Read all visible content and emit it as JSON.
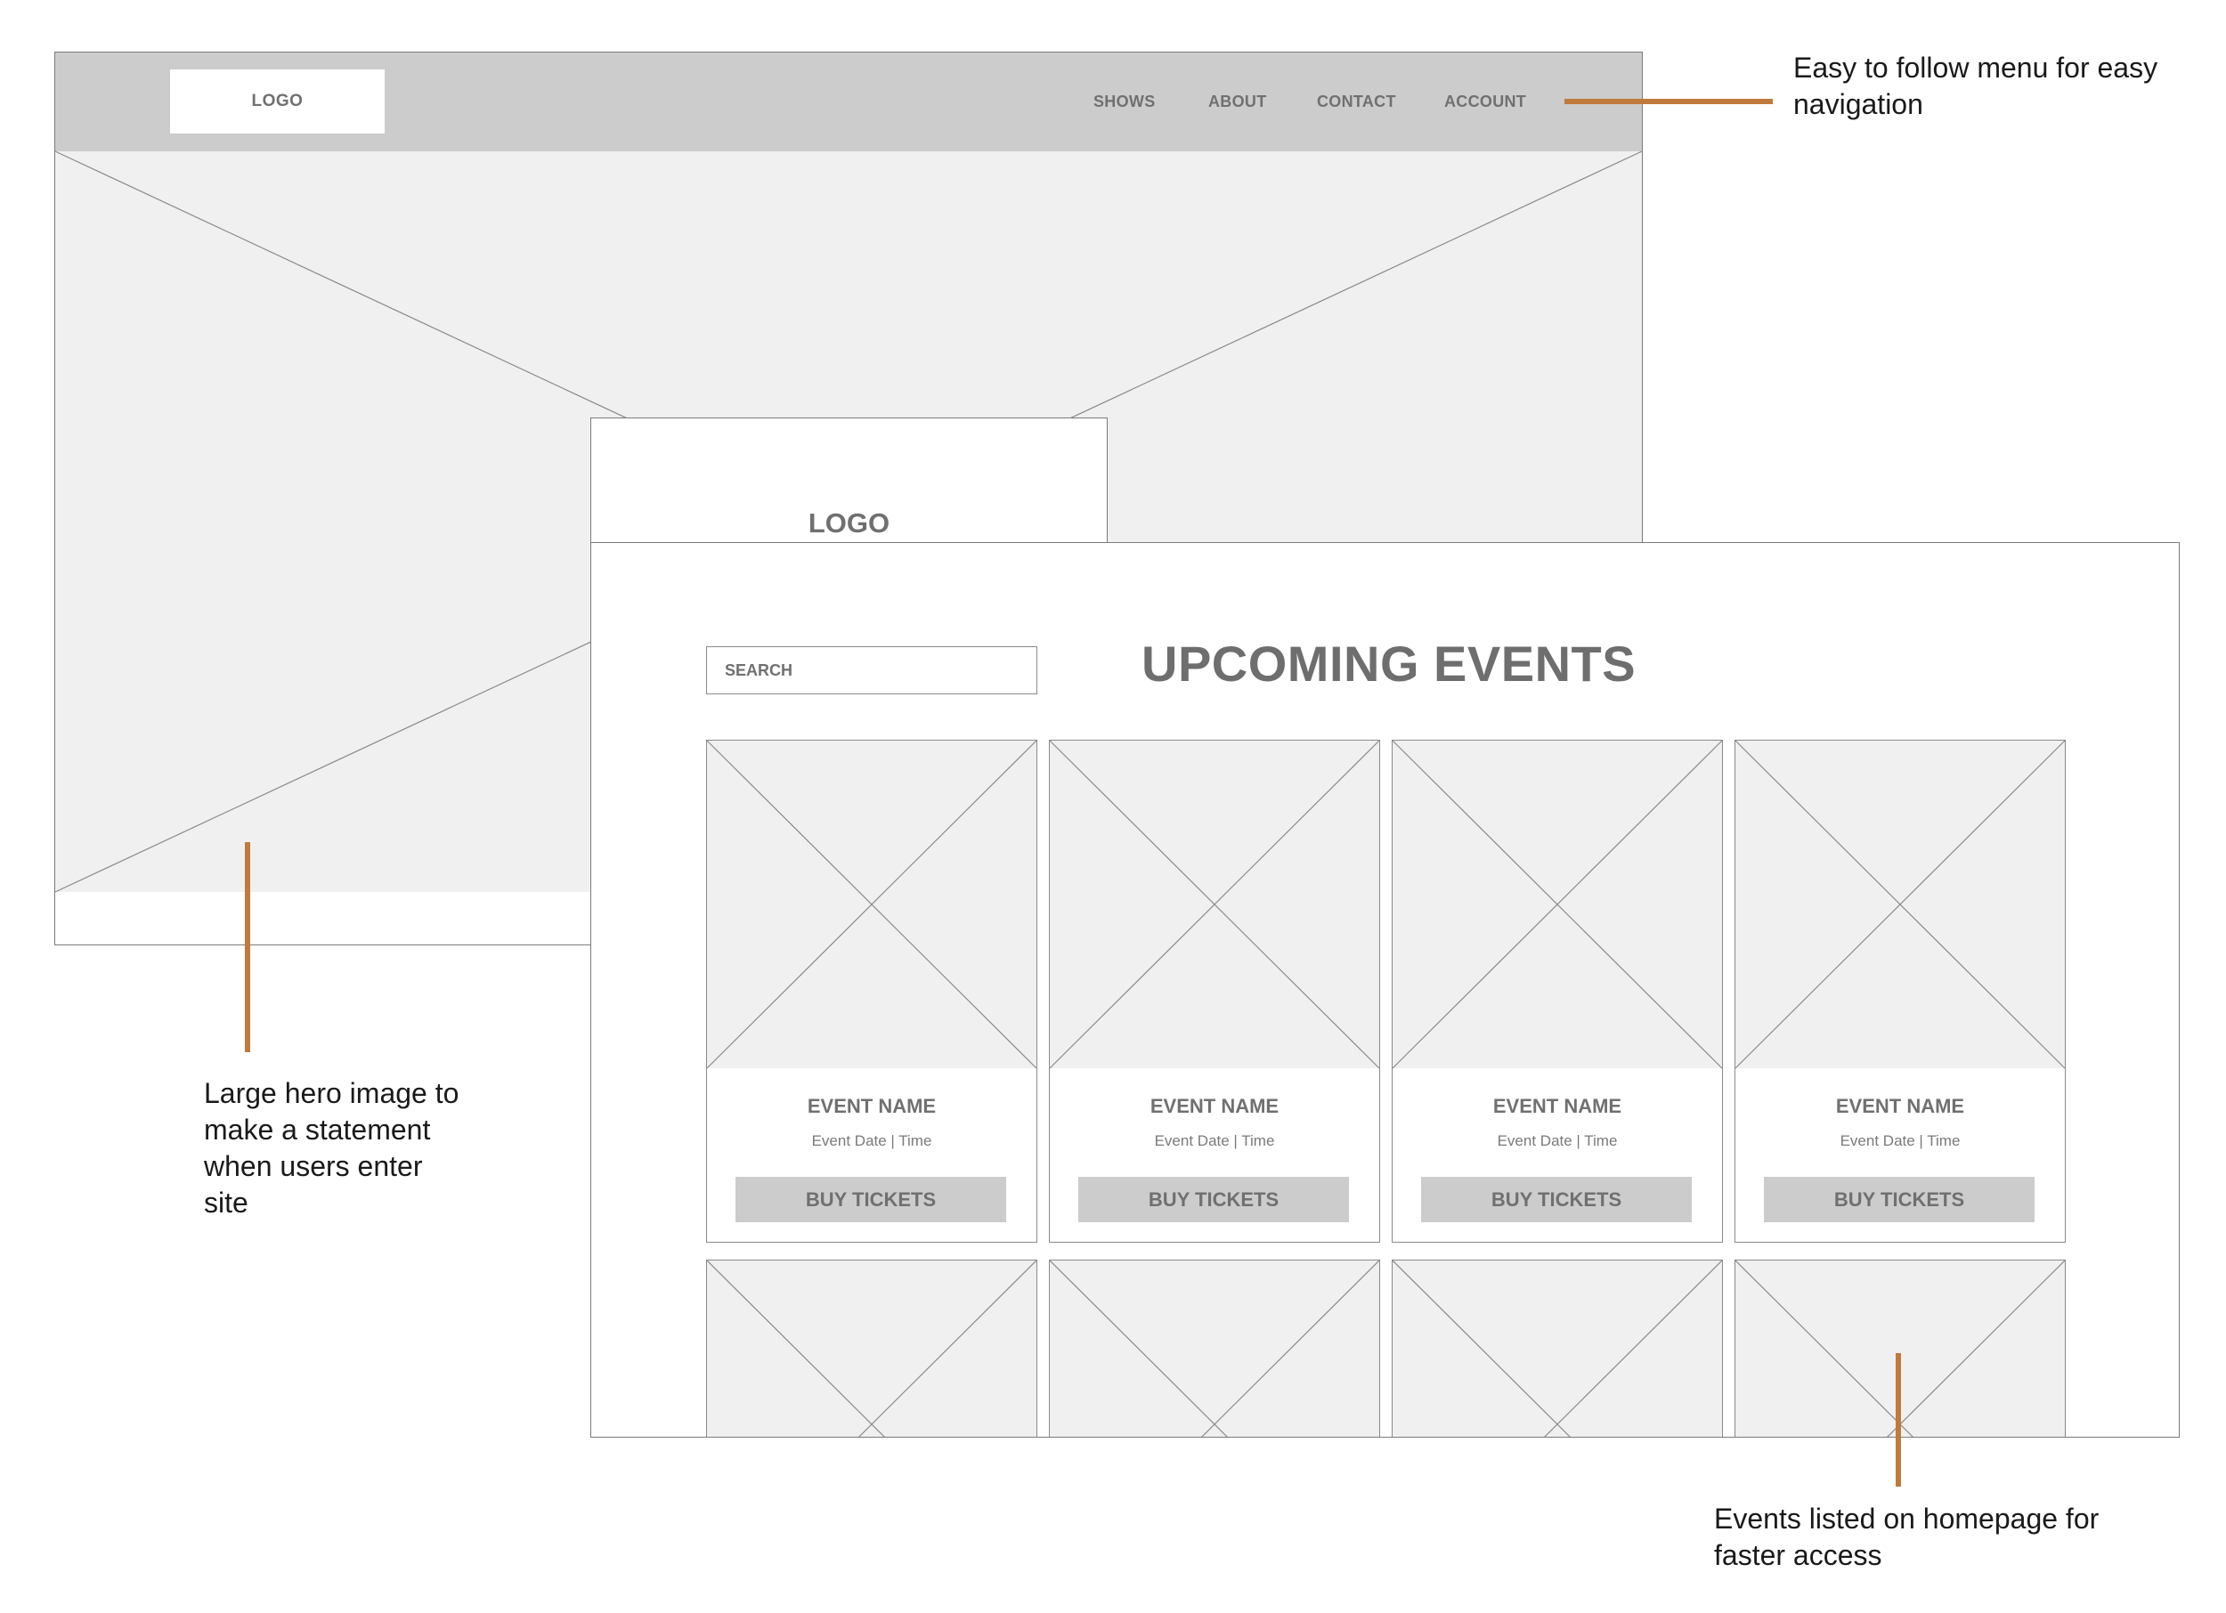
{
  "colors": {
    "accent": "#c07a3c",
    "placeholder_fill": "#f0f0f0",
    "nav_fill": "#cccccc",
    "frame_line": "#7a7a7a",
    "text_gray": "#707070"
  },
  "homepage": {
    "logo_label": "LOGO",
    "nav_items": [
      "SHOWS",
      "ABOUT",
      "CONTACT",
      "ACCOUNT"
    ],
    "hero_image": "image-placeholder-icon"
  },
  "events_page": {
    "logo_label": "LOGO",
    "search_placeholder": "SEARCH",
    "title": "UPCOMING EVENTS",
    "events": [
      {
        "name": "EVENT NAME",
        "date_time": "Event Date | Time",
        "button": "BUY TICKETS"
      },
      {
        "name": "EVENT NAME",
        "date_time": "Event Date | Time",
        "button": "BUY TICKETS"
      },
      {
        "name": "EVENT NAME",
        "date_time": "Event Date | Time",
        "button": "BUY TICKETS"
      },
      {
        "name": "EVENT NAME",
        "date_time": "Event Date | Time",
        "button": "BUY TICKETS"
      }
    ]
  },
  "annotations": {
    "menu": "Easy to follow menu for easy navigation",
    "hero": "Large hero image to make a statement when users enter site",
    "events": "Events listed on homepage for faster access"
  }
}
